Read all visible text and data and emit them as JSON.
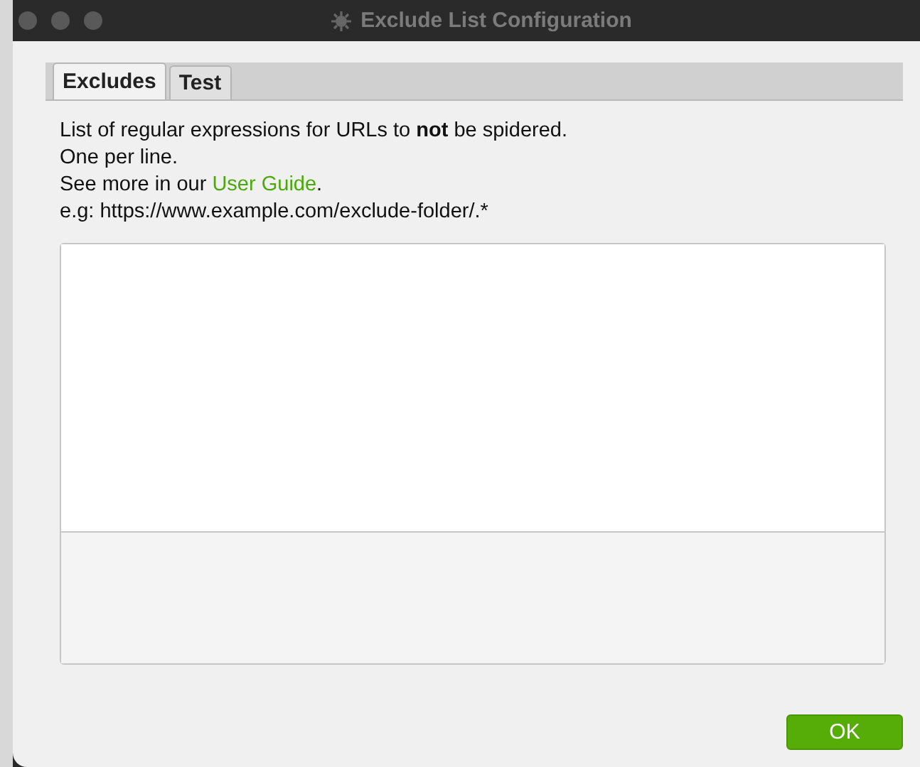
{
  "window": {
    "title": "Exclude List Configuration"
  },
  "tabs": [
    {
      "label": "Excludes",
      "selected": true
    },
    {
      "label": "Test",
      "selected": false
    }
  ],
  "description": [
    "List of regular expressions for URLs to **not** be spidered.",
    "One per line."
  ],
  "guide": {
    "prefix": "See more in our ",
    "link": "User Guide",
    "suffix": "."
  },
  "example": "e.g: https://www.example.com/exclude-folder/.*",
  "buttons": [
    "OK"
  ]
}
